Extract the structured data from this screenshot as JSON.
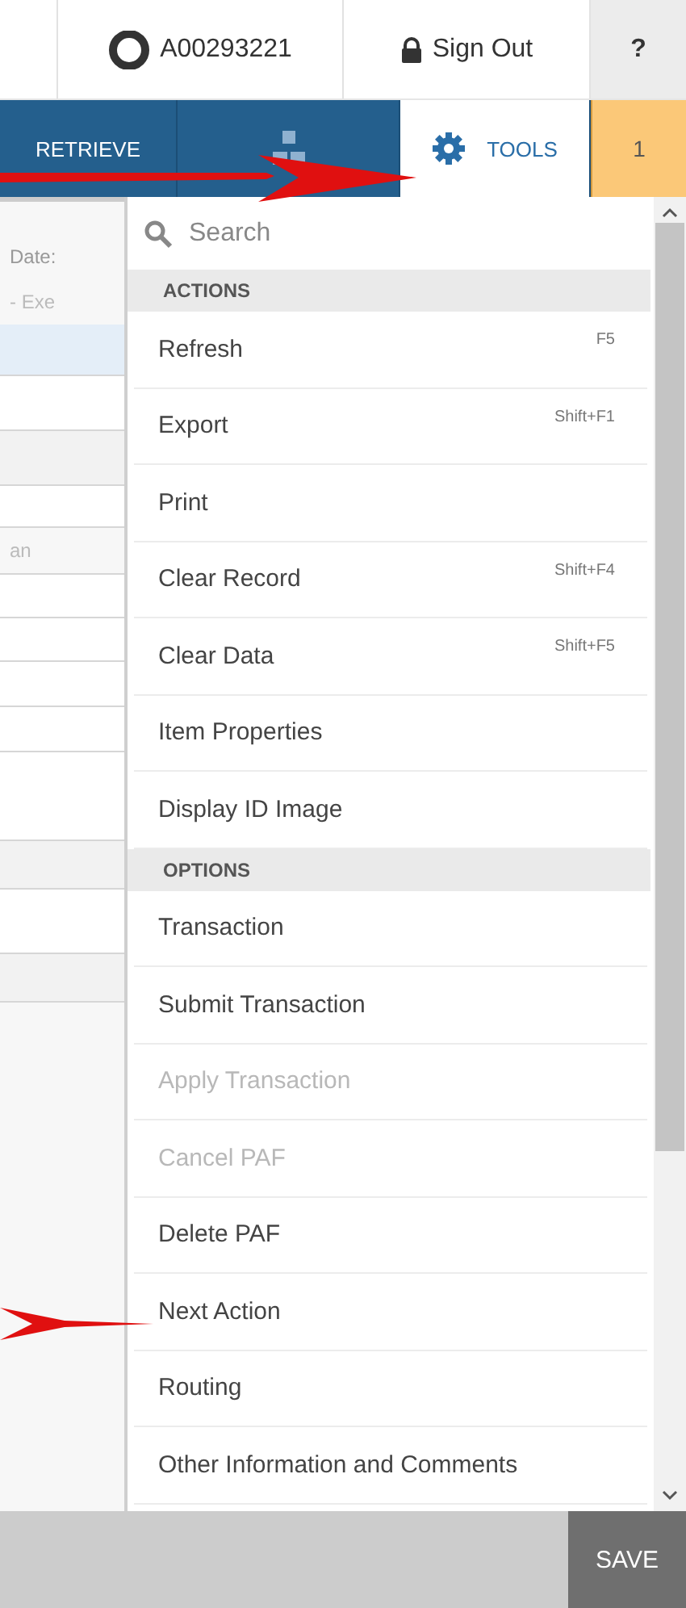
{
  "header": {
    "user_id": "A00293221",
    "sign_out": "Sign Out",
    "help": "?"
  },
  "nav": {
    "items": [
      {
        "kind": "text",
        "label": "RETRIEVE",
        "selected": false
      },
      {
        "kind": "icon",
        "selected": false
      },
      {
        "kind": "tools",
        "label": "TOOLS",
        "selected": true
      }
    ],
    "badge": "1"
  },
  "background_form": {
    "texts": [
      {
        "text": "Date:",
        "kind": "label"
      },
      {
        "text": "- Exe",
        "kind": "value"
      },
      {
        "text": "an",
        "kind": "value"
      }
    ]
  },
  "menu": {
    "search": {
      "placeholder": "Search"
    },
    "entries": [
      {
        "kind": "header",
        "label": "ACTIONS"
      },
      {
        "kind": "item",
        "label": "Refresh",
        "shortcut": "F5",
        "disabled": false
      },
      {
        "kind": "item",
        "label": "Export",
        "shortcut": "Shift+F1",
        "disabled": false
      },
      {
        "kind": "item",
        "label": "Print",
        "disabled": false
      },
      {
        "kind": "item",
        "label": "Clear Record",
        "shortcut": "Shift+F4",
        "disabled": false
      },
      {
        "kind": "item",
        "label": "Clear Data",
        "shortcut": "Shift+F5",
        "disabled": false
      },
      {
        "kind": "item",
        "label": "Item Properties",
        "disabled": false
      },
      {
        "kind": "item",
        "label": "Display ID Image",
        "disabled": false
      },
      {
        "kind": "header",
        "label": "OPTIONS"
      },
      {
        "kind": "item",
        "label": "Transaction",
        "disabled": false
      },
      {
        "kind": "item",
        "label": "Submit Transaction",
        "disabled": false
      },
      {
        "kind": "item",
        "label": "Apply Transaction",
        "disabled": true
      },
      {
        "kind": "item",
        "label": "Cancel PAF",
        "disabled": true
      },
      {
        "kind": "item",
        "label": "Delete PAF",
        "disabled": false
      },
      {
        "kind": "item",
        "label": "Next Action",
        "disabled": false
      },
      {
        "kind": "item",
        "label": "Routing",
        "disabled": false
      },
      {
        "kind": "item",
        "label": "Other Information and Comments",
        "disabled": false
      }
    ]
  },
  "footer": {
    "save": "SAVE"
  }
}
